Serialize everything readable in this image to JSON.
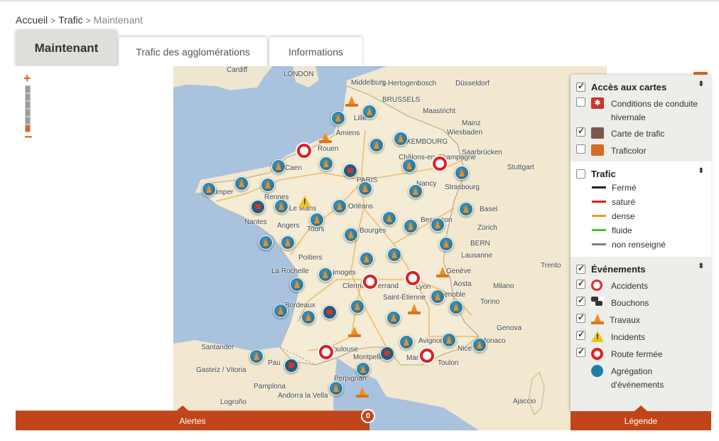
{
  "breadcrumb": {
    "home": "Accueil",
    "trafic": "Trafic",
    "current": "Maintenant",
    "sep": ">"
  },
  "tabs": {
    "active": "Maintenant",
    "agglo": "Trafic des agglomérations",
    "info": "Informations"
  },
  "zoom": {
    "plus": "+",
    "minus": "−",
    "level": 6,
    "levels": 7
  },
  "map": {
    "cities": [
      "Cardiff",
      "LONDON",
      "Middelburg",
      "'s-Hertogenbosch",
      "Düsseldorf",
      "BRUSSELS",
      "Maastricht",
      "Lille",
      "Amiens",
      "LUXEMBOURG",
      "Wiesbaden",
      "Mainz",
      "Rouen",
      "Saarbrücken",
      "Caen",
      "Châlons-en-Champagne",
      "Stuttgart",
      "Quimper",
      "Rennes",
      "PARIS",
      "Nancy",
      "Strasbourg",
      "Le Mans",
      "Orléans",
      "Basel",
      "Nantes",
      "Angers",
      "Tours",
      "Bourges",
      "Besançon",
      "Zürich",
      "BERN",
      "Poitiers",
      "Lausanne",
      "La Rochelle",
      "Limoges",
      "Genève",
      "Trento",
      "Clermont-Ferrand",
      "Lyon",
      "Aosta",
      "Milano",
      "Bordeaux",
      "Saint-Étienne",
      "Grenoble",
      "Torino",
      "Genova",
      "Santander",
      "Toulouse",
      "Montpellier",
      "Avignon",
      "Nice",
      "Monaco",
      "Marseille",
      "Toulon",
      "Gasteiz / Vitoria",
      "Pau",
      "Pamplona",
      "Perpignan",
      "Andorra la Vella",
      "Logroño",
      "Ajaccio"
    ]
  },
  "legend": {
    "cartes": {
      "title": "Accès aux cartes",
      "items": [
        {
          "label": "Conditions de conduite hivernale",
          "checked": false,
          "color": "#c8372d"
        },
        {
          "label": "Carte de trafic",
          "checked": true,
          "color": "#7a5a4a"
        },
        {
          "label": "Traficolor",
          "checked": false,
          "color": "#d86a22"
        }
      ]
    },
    "trafic": {
      "title": "Trafic",
      "items": [
        {
          "label": "Fermé",
          "color": "#222222"
        },
        {
          "label": "saturé",
          "color": "#d8201e"
        },
        {
          "label": "dense",
          "color": "#f29a1e"
        },
        {
          "label": "fluide",
          "color": "#3ec82b"
        },
        {
          "label": "non renseigné",
          "color": "#808080"
        }
      ]
    },
    "evenements": {
      "title": "Événements",
      "items": [
        {
          "label": "Accidents",
          "icon": "accident-icon"
        },
        {
          "label": "Bouchons",
          "icon": "bouchon-icon"
        },
        {
          "label": "Travaux",
          "icon": "travaux-cone-icon"
        },
        {
          "label": "Incidents",
          "icon": "incident-warning-icon"
        },
        {
          "label": "Route fermée",
          "icon": "route-fermee-icon"
        },
        {
          "label": "Agrégation d'événements",
          "icon": "aggregation-icon"
        }
      ]
    },
    "toggle_label": "Légende"
  },
  "alertes": {
    "label": "Alertes",
    "count": "0"
  }
}
